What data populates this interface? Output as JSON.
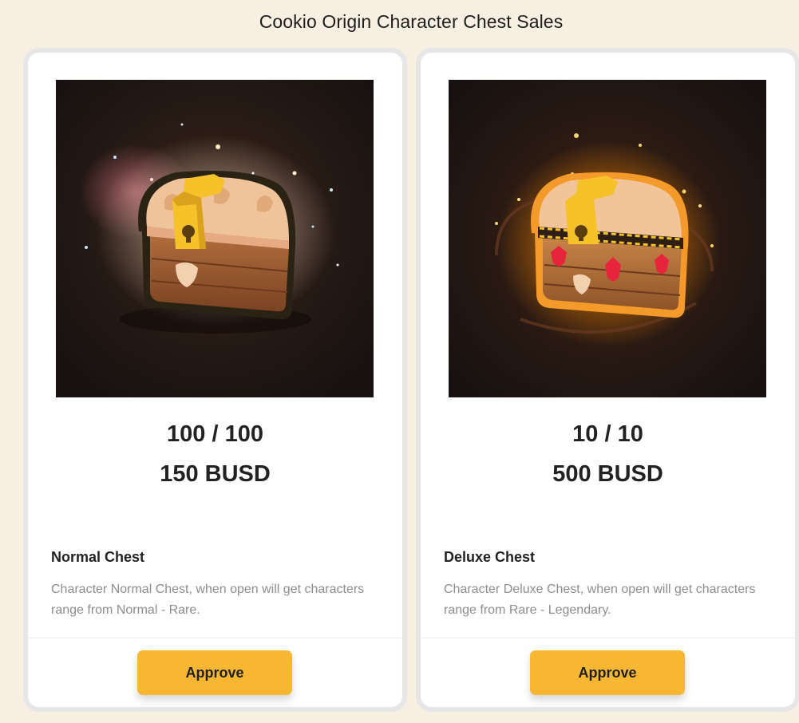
{
  "page": {
    "title": "Cookio Origin Character Chest Sales"
  },
  "colors": {
    "background": "#f8efe3",
    "button": "#f7b733",
    "card_border": "#e6e6e6",
    "description_text": "#8d8d8d"
  },
  "chests": [
    {
      "image_alt": "normal-chest-icon",
      "count": "100 / 100",
      "price": "150 BUSD",
      "name": "Normal Chest",
      "description": "Character Normal Chest, when open will get characters range from Normal - Rare.",
      "button_label": "Approve"
    },
    {
      "image_alt": "deluxe-chest-icon",
      "count": "10 / 10",
      "price": "500 BUSD",
      "name": "Deluxe Chest",
      "description": "Character Deluxe Chest, when open will get characters range from Rare - Legendary.",
      "button_label": "Approve"
    }
  ]
}
